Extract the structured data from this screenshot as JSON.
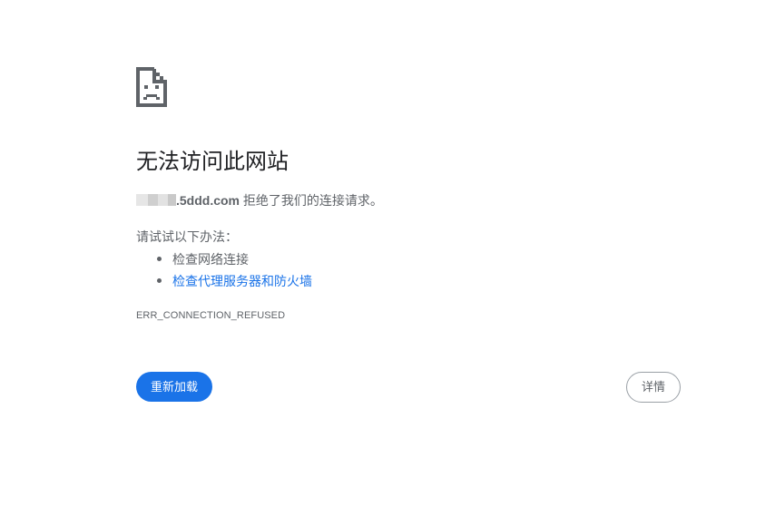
{
  "error": {
    "icon": "sad-page-icon",
    "title": "无法访问此网站",
    "host": ".5ddd.com",
    "message": " 拒绝了我们的连接请求。",
    "suggestions_heading": "请试试以下办法：",
    "suggestions": [
      {
        "label": "检查网络连接",
        "is_link": false
      },
      {
        "label": "检查代理服务器和防火墙",
        "is_link": true
      }
    ],
    "code": "ERR_CONNECTION_REFUSED"
  },
  "buttons": {
    "reload_label": "重新加载",
    "details_label": "详情"
  },
  "colors": {
    "accent": "#1a73e8",
    "text_primary": "#202124",
    "text_secondary": "#5f6368",
    "border": "#9aa0a6",
    "background": "#ffffff"
  }
}
